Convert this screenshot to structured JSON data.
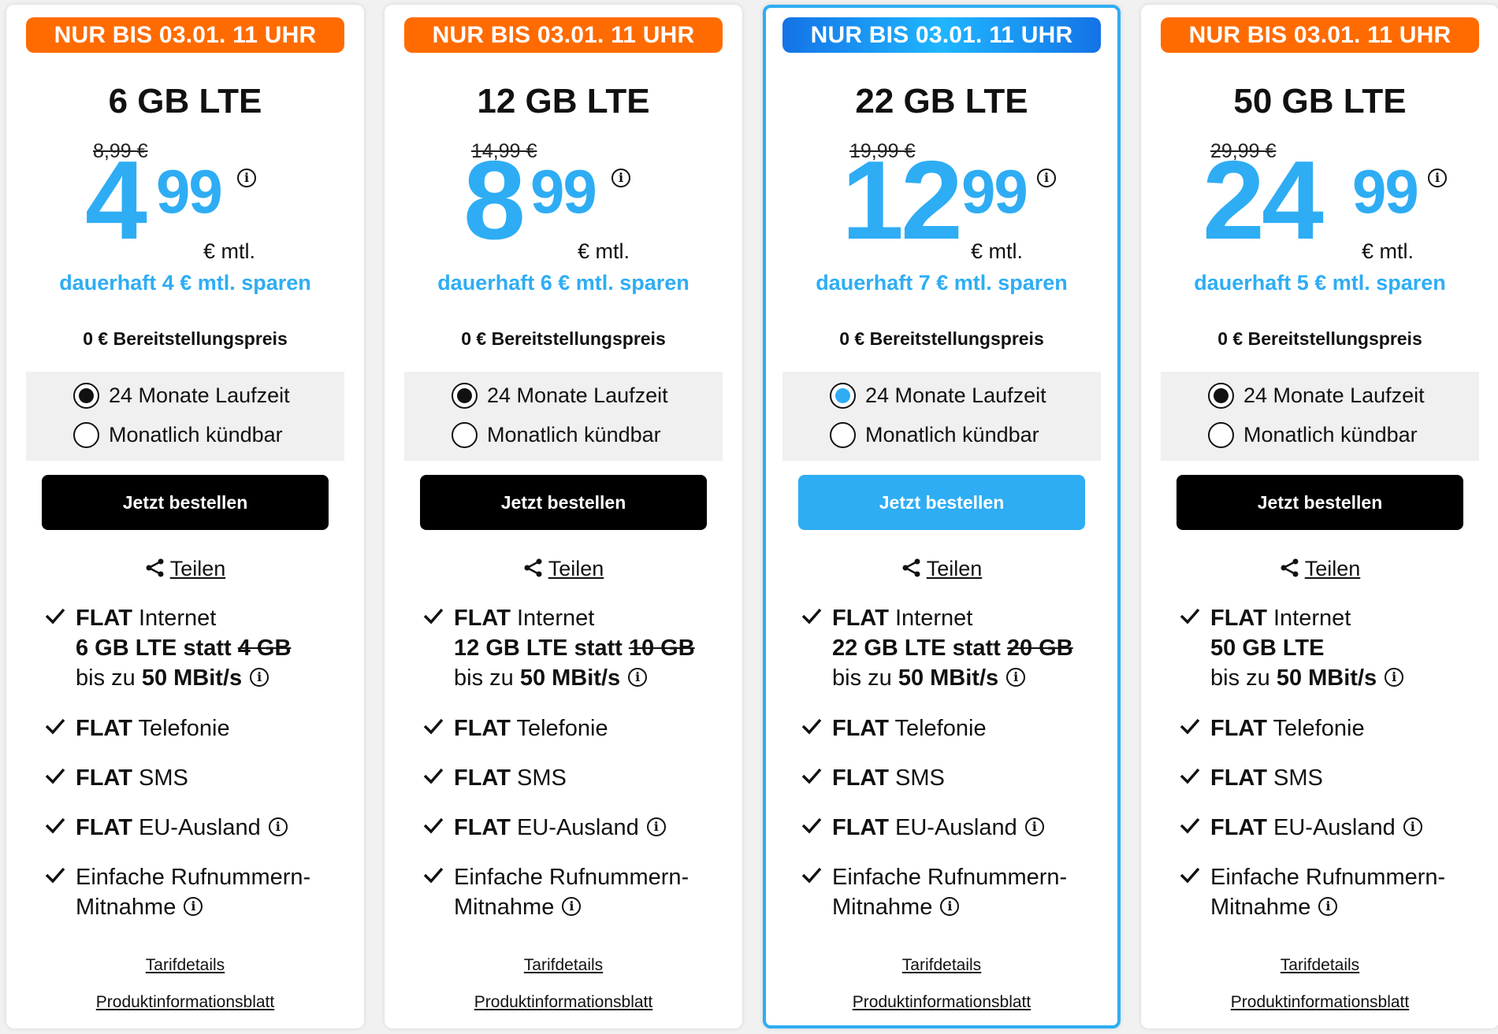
{
  "plans": [
    {
      "badge": "NUR BIS 03.01. 11 UHR",
      "title": "6 GB LTE",
      "old_price": "8,99 €",
      "price_main": "4",
      "price_cents": "99",
      "price_unit": "€ mtl.",
      "savings": "dauerhaft 4 € mtl. sparen",
      "setup": "0 € Bereitstellungspreis",
      "option1": "24 Monate Laufzeit",
      "option2": "Monatlich kündbar",
      "order": "Jetzt bestellen",
      "share": "Teilen",
      "feat_internet_bold": "FLAT",
      "feat_internet": "Internet",
      "feat_volume": "6 GB LTE",
      "feat_statt": "statt",
      "feat_old_volume": "4 GB",
      "feat_speed_prefix": "bis zu",
      "feat_speed": "50 MBit/s",
      "feat_tel_bold": "FLAT",
      "feat_tel": "Telefonie",
      "feat_sms_bold": "FLAT",
      "feat_sms": "SMS",
      "feat_eu_bold": "FLAT",
      "feat_eu": "EU-Ausland",
      "feat_port1": "Einfache Rufnummern-",
      "feat_port2": "Mitnahme",
      "link1": "Tarifdetails",
      "link2": "Produktinformationsblatt"
    },
    {
      "badge": "NUR BIS 03.01. 11 UHR",
      "title": "12 GB LTE",
      "old_price": "14,99 €",
      "price_main": "8",
      "price_cents": "99",
      "price_unit": "€ mtl.",
      "savings": "dauerhaft 6 € mtl. sparen",
      "setup": "0 € Bereitstellungspreis",
      "option1": "24 Monate Laufzeit",
      "option2": "Monatlich kündbar",
      "order": "Jetzt bestellen",
      "share": "Teilen",
      "feat_internet_bold": "FLAT",
      "feat_internet": "Internet",
      "feat_volume": "12 GB LTE",
      "feat_statt": "statt",
      "feat_old_volume": "10 GB",
      "feat_speed_prefix": "bis zu",
      "feat_speed": "50 MBit/s",
      "feat_tel_bold": "FLAT",
      "feat_tel": "Telefonie",
      "feat_sms_bold": "FLAT",
      "feat_sms": "SMS",
      "feat_eu_bold": "FLAT",
      "feat_eu": "EU-Ausland",
      "feat_port1": "Einfache Rufnummern-",
      "feat_port2": "Mitnahme",
      "link1": "Tarifdetails",
      "link2": "Produktinformationsblatt"
    },
    {
      "badge": "NUR BIS 03.01. 11 UHR",
      "title": "22 GB LTE",
      "old_price": "19,99 €",
      "price_main": "12",
      "price_cents": "99",
      "price_unit": "€ mtl.",
      "savings": "dauerhaft 7 € mtl. sparen",
      "setup": "0 € Bereitstellungspreis",
      "option1": "24 Monate Laufzeit",
      "option2": "Monatlich kündbar",
      "order": "Jetzt bestellen",
      "share": "Teilen",
      "feat_internet_bold": "FLAT",
      "feat_internet": "Internet",
      "feat_volume": "22 GB LTE",
      "feat_statt": "statt",
      "feat_old_volume": "20 GB",
      "feat_speed_prefix": "bis zu",
      "feat_speed": "50 MBit/s",
      "feat_tel_bold": "FLAT",
      "feat_tel": "Telefonie",
      "feat_sms_bold": "FLAT",
      "feat_sms": "SMS",
      "feat_eu_bold": "FLAT",
      "feat_eu": "EU-Ausland",
      "feat_port1": "Einfache Rufnummern-",
      "feat_port2": "Mitnahme",
      "link1": "Tarifdetails",
      "link2": "Produktinformationsblatt"
    },
    {
      "badge": "NUR BIS 03.01. 11 UHR",
      "title": "50 GB LTE",
      "old_price": "29,99 €",
      "price_main": "24",
      "price_cents": "99",
      "price_unit": "€ mtl.",
      "savings": "dauerhaft 5 € mtl. sparen",
      "setup": "0 € Bereitstellungspreis",
      "option1": "24 Monate Laufzeit",
      "option2": "Monatlich kündbar",
      "order": "Jetzt bestellen",
      "share": "Teilen",
      "feat_internet_bold": "FLAT",
      "feat_internet": "Internet",
      "feat_volume": "50 GB LTE",
      "feat_speed_prefix": "bis zu",
      "feat_speed": "50 MBit/s",
      "feat_tel_bold": "FLAT",
      "feat_tel": "Telefonie",
      "feat_sms_bold": "FLAT",
      "feat_sms": "SMS",
      "feat_eu_bold": "FLAT",
      "feat_eu": "EU-Ausland",
      "feat_port1": "Einfache Rufnummern-",
      "feat_port2": "Mitnahme",
      "link1": "Tarifdetails",
      "link2": "Produktinformationsblatt"
    }
  ],
  "colors": {
    "accent_blue": "#2eadf4",
    "badge_orange": "#ff6b00",
    "button_black": "#000000"
  },
  "icons": {
    "info": "info-icon",
    "check": "check-icon",
    "share": "share-icon"
  }
}
